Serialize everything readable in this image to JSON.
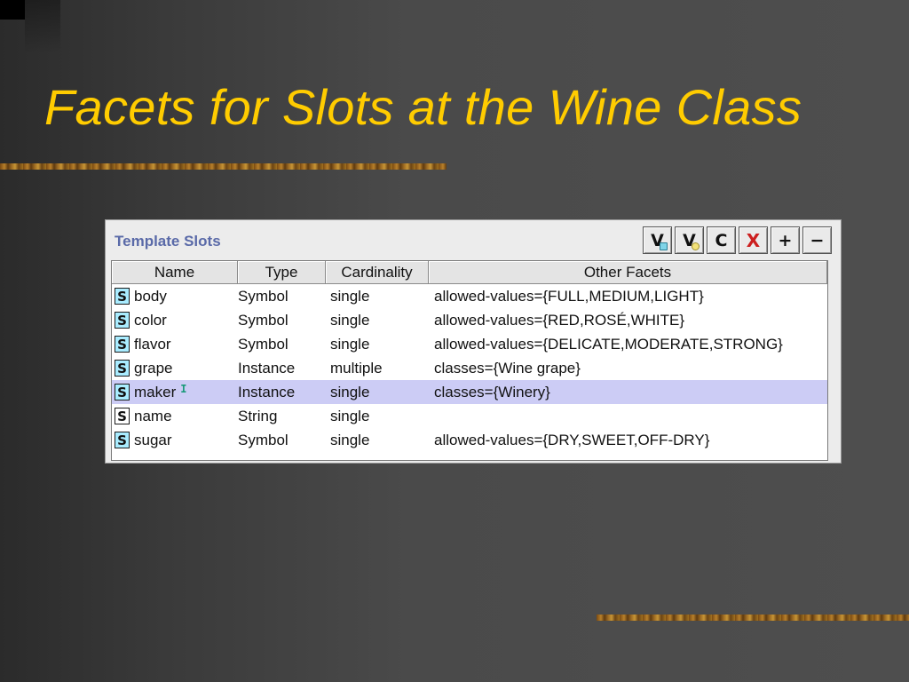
{
  "slide": {
    "title": "Facets for Slots at the Wine Class"
  },
  "panel": {
    "title": "Template Slots",
    "toolbar": [
      "V",
      "V",
      "C",
      "X",
      "+",
      "−"
    ],
    "columns": [
      "Name",
      "Type",
      "Cardinality",
      "Other Facets"
    ],
    "rows": [
      {
        "icon": "S",
        "name": "body",
        "type": "Symbol",
        "cardinality": "single",
        "other": "allowed-values={FULL,MEDIUM,LIGHT}"
      },
      {
        "icon": "S",
        "name": "color",
        "type": "Symbol",
        "cardinality": "single",
        "other": "allowed-values={RED,ROSÉ,WHITE}"
      },
      {
        "icon": "S",
        "name": "flavor",
        "type": "Symbol",
        "cardinality": "single",
        "other": "allowed-values={DELICATE,MODERATE,STRONG}"
      },
      {
        "icon": "S",
        "name": "grape",
        "type": "Instance",
        "cardinality": "multiple",
        "other": "classes={Wine grape}"
      },
      {
        "icon": "S",
        "name": "maker",
        "type": "Instance",
        "cardinality": "single",
        "other": "classes={Winery}"
      },
      {
        "icon": "S",
        "name": "name",
        "type": "String",
        "cardinality": "single",
        "other": ""
      },
      {
        "icon": "S",
        "name": "sugar",
        "type": "Symbol",
        "cardinality": "single",
        "other": "allowed-values={DRY,SWEET,OFF-DRY}"
      }
    ],
    "selected_row": "maker"
  },
  "colors": {
    "title": "#ffcc00",
    "selection": "#ccccf5",
    "slot_icon_fill": "#a9ecff",
    "panel_title": "#5a6aa8"
  }
}
